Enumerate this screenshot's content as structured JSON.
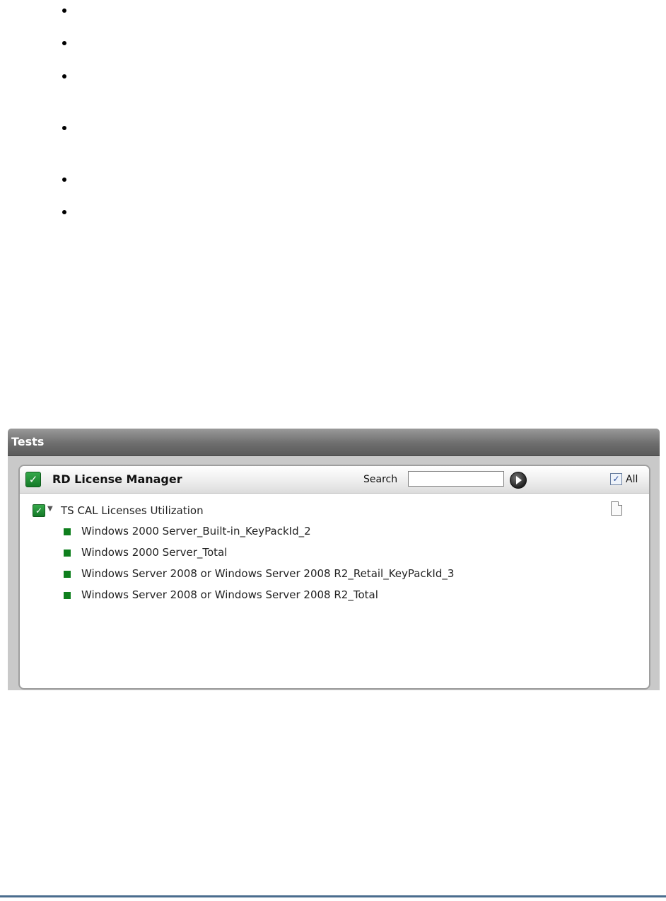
{
  "panel": {
    "header_title": "Tests"
  },
  "component": {
    "title": "RD License Manager",
    "search_label": "Search",
    "search_value": "",
    "all_label": "All",
    "all_checked": true
  },
  "tree": {
    "root_label": "TS CAL Licenses Utilization",
    "children": [
      "Windows 2000 Server_Built-in_KeyPackId_2",
      "Windows 2000 Server_Total",
      "Windows Server 2008 or Windows Server 2008 R2_Retail_KeyPackId_3",
      "Windows Server 2008 or Windows Server 2008 R2_Total"
    ]
  },
  "colors": {
    "status_ok": "#0e7f1d",
    "header_bg": "#6e6e6e",
    "footer_rule": "#4a6d8e"
  }
}
